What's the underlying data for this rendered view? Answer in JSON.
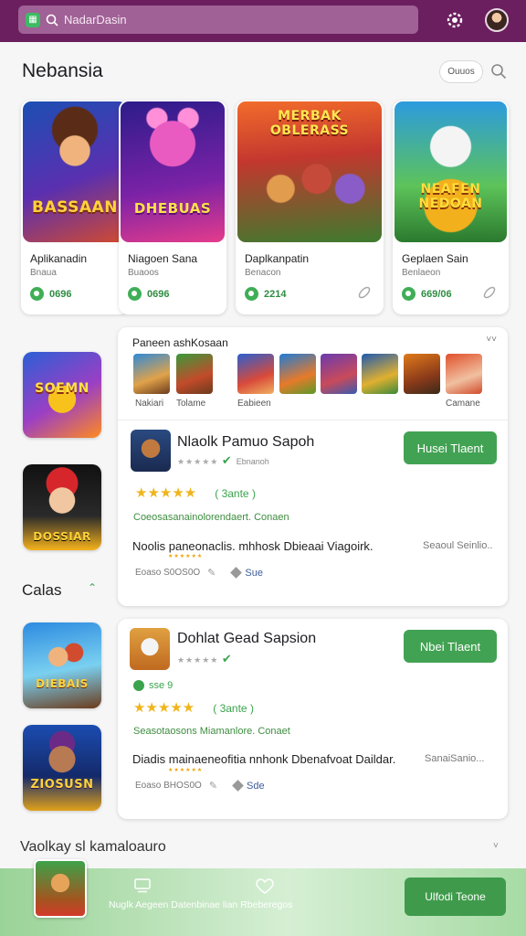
{
  "topbar": {
    "search_text": "NadarDasin"
  },
  "section": {
    "title": "Nebansia",
    "pill_label": "Ouuos"
  },
  "featured": [
    {
      "art_label": "BASSAAN",
      "title": "Aplikanadin",
      "subtitle": "Bnaua",
      "badge": "0696"
    },
    {
      "art_label": "DHEBUAS",
      "title": "Niagoen Sana",
      "subtitle": "Buaoos",
      "badge": "0696"
    },
    {
      "art_label": "MERBAK OBLERASS",
      "title": "Daplkanpatin",
      "subtitle": "Benacon",
      "badge": "2214"
    },
    {
      "art_label": "NEAFEN NEDOAN",
      "title": "Geplaen Sain",
      "subtitle": "Benlaeon",
      "badge": "669/06"
    }
  ],
  "left_icons": [
    {
      "label": "SOEMN"
    },
    {
      "label": "DOSSIAR"
    },
    {
      "label": "DIEBAIS"
    },
    {
      "label": "ZIOSUSN"
    }
  ],
  "categories_label": "Calas",
  "panel1": {
    "header": "Paneen ashKosaan",
    "thumb_labels": [
      "Nakiari",
      "Tolame",
      "Eabieen",
      "Camane"
    ],
    "app": {
      "name": "Nlaolk Pamuo Sapoh",
      "developer": "Ebnanoh",
      "install_label": "Husei Tlaent",
      "rating_text": "( 3ante  )",
      "green_line": "Coeosasanainolorendaert.  Conaen",
      "description": "Noolis paneonaclis. mhhosk Dbieaai Viagoirk.",
      "desc_right": "Seaoul Seinlio..",
      "meta_left": "Eoaso S0OS0O",
      "tag": "Sue"
    }
  },
  "panel2": {
    "app": {
      "name": "Dohlat Gead Sapsion",
      "developer": "",
      "install_label": "Nbei Tlaent",
      "mini_badge": "sse 9",
      "rating_text": "( 3ante  )",
      "green_line": "Seasotaosons Miamanlore. Conaet",
      "description": "Diadis mainaeneofitia nnhonk Dbenafvoat Daildar.",
      "desc_right": "SanaiSanio...",
      "meta_left": "Eoaso BHOS0O",
      "tag": "Sde"
    }
  },
  "bottom": {
    "title": "Vaolkay sl kamaloauro",
    "bar_text": "Nuglk Aegeen Datenbinae  lian Rbeberegos",
    "button_label": "Ulfodi Teone"
  },
  "colors": {
    "topbar": "#6b1f5e",
    "accent_green": "#42a253",
    "star": "#f0b51a"
  },
  "icons": [
    "app-logo-icon",
    "search-icon",
    "gear-icon",
    "avatar",
    "link-icon",
    "check-icon",
    "pencil-icon",
    "tag-icon",
    "grid-icon",
    "heart-icon"
  ]
}
